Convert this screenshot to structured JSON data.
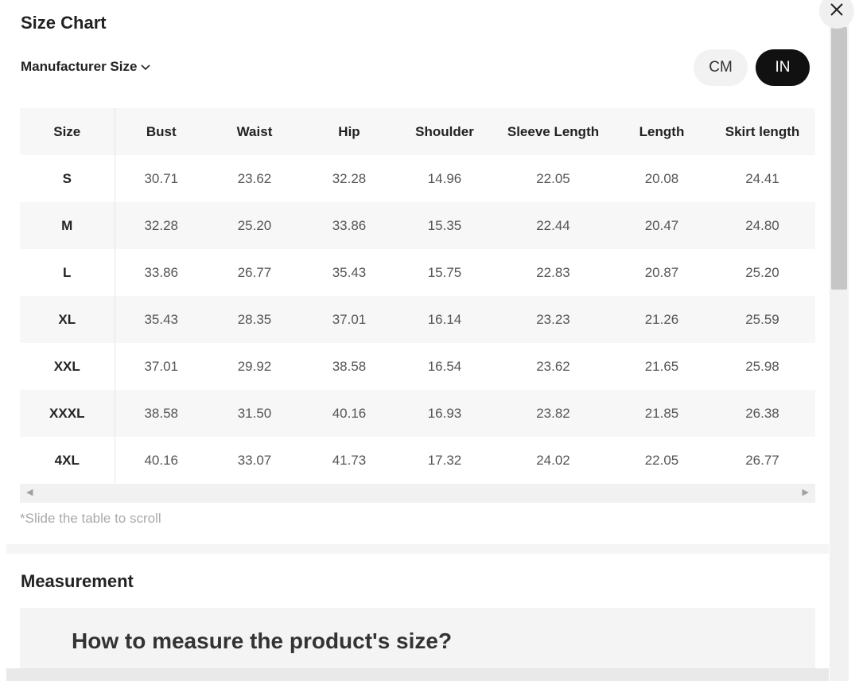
{
  "header": {
    "title": "Size Chart",
    "manufacturer_label": "Manufacturer Size"
  },
  "units": {
    "options": [
      "CM",
      "IN"
    ],
    "selected": "IN"
  },
  "table": {
    "columns": [
      "Size",
      "Bust",
      "Waist",
      "Hip",
      "Shoulder",
      "Sleeve Length",
      "Length",
      "Skirt length"
    ],
    "rows": [
      [
        "S",
        "30.71",
        "23.62",
        "32.28",
        "14.96",
        "22.05",
        "20.08",
        "24.41"
      ],
      [
        "M",
        "32.28",
        "25.20",
        "33.86",
        "15.35",
        "22.44",
        "20.47",
        "24.80"
      ],
      [
        "L",
        "33.86",
        "26.77",
        "35.43",
        "15.75",
        "22.83",
        "20.87",
        "25.20"
      ],
      [
        "XL",
        "35.43",
        "28.35",
        "37.01",
        "16.14",
        "23.23",
        "21.26",
        "25.59"
      ],
      [
        "XXL",
        "37.01",
        "29.92",
        "38.58",
        "16.54",
        "23.62",
        "21.65",
        "25.98"
      ],
      [
        "XXXL",
        "38.58",
        "31.50",
        "40.16",
        "16.93",
        "23.82",
        "21.85",
        "26.38"
      ],
      [
        "4XL",
        "40.16",
        "33.07",
        "41.73",
        "17.32",
        "24.02",
        "22.05",
        "26.77"
      ]
    ]
  },
  "hint": "*Slide the table to scroll",
  "measurement": {
    "title": "Measurement",
    "question": "How to measure the product's size?"
  },
  "icons": {
    "close": "close-icon",
    "chevron": "chevron-down-icon",
    "scroll_left": "arrow-left-icon",
    "scroll_right": "arrow-right-icon"
  },
  "colors": {
    "selected_unit_bg": "#111111",
    "row_shade": "#f7f7f7"
  }
}
